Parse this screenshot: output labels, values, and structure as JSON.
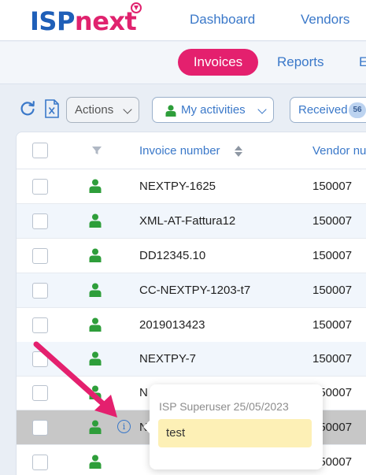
{
  "brand": {
    "part1": "ISP",
    "part2": "next",
    "accent": "#e0226e",
    "primary": "#1f5fb8"
  },
  "topnav": {
    "dashboard": "Dashboard",
    "vendors": "Vendors"
  },
  "subnav": {
    "active": "Invoices",
    "reports": "Reports",
    "more": "E"
  },
  "toolbar": {
    "refresh_icon": "refresh-icon",
    "excel_icon": "excel-export-icon",
    "actions_label": "Actions",
    "activities_label": "My activities",
    "received_label": "Received",
    "received_count": "56"
  },
  "table": {
    "columns": {
      "invoice_number": "Invoice number",
      "vendor_number": "Vendor nu"
    },
    "rows": [
      {
        "invoice": "NEXTPY-1625",
        "vendor": "150007"
      },
      {
        "invoice": "XML-AT-Fattura12",
        "vendor": "150007"
      },
      {
        "invoice": "DD12345.10",
        "vendor": "150007"
      },
      {
        "invoice": "CC-NEXTPY-1203-t7",
        "vendor": "150007"
      },
      {
        "invoice": "2019013423",
        "vendor": "150007"
      },
      {
        "invoice": "NEXTPY-7",
        "vendor": "150007"
      },
      {
        "invoice": "N",
        "vendor": "150007"
      },
      {
        "invoice": "N",
        "vendor": "150007"
      },
      {
        "invoice": "",
        "vendor": "150007"
      }
    ]
  },
  "popover": {
    "header": "ISP Superuser 25/05/2023",
    "note": "test"
  },
  "colors": {
    "user_icon": "#2e9e3a",
    "link": "#3a78c9",
    "annotation_arrow": "#e4206e",
    "note_bg": "#fdf0b6"
  }
}
